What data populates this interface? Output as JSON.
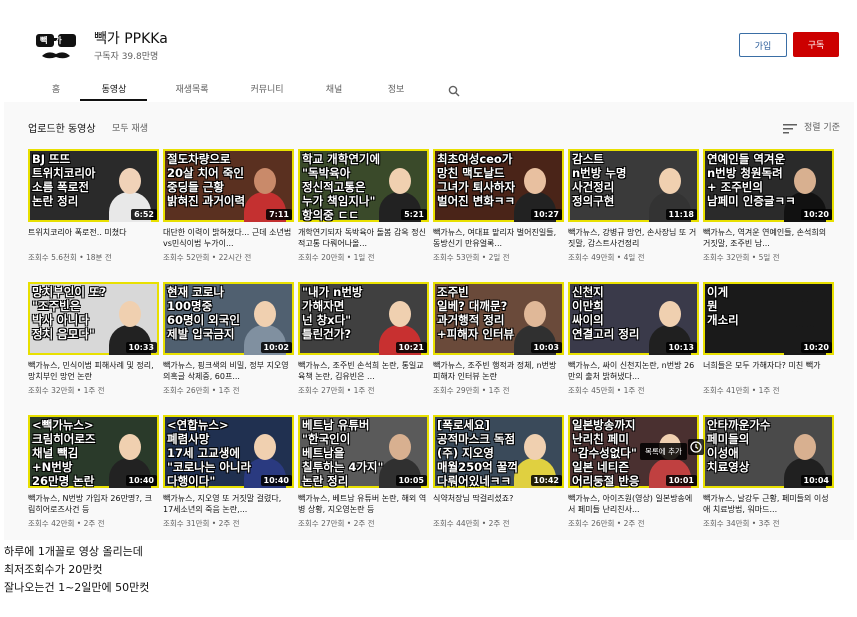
{
  "channel": {
    "name": "빽가 PPKKa",
    "subscribers": "구독자 39.8만명",
    "avatar_text": "빽가",
    "join_label": "가입",
    "subscribe_label": "구독"
  },
  "tabs": [
    {
      "label": "홈"
    },
    {
      "label": "동영상",
      "active": true
    },
    {
      "label": "재생목록"
    },
    {
      "label": "커뮤니티"
    },
    {
      "label": "채널"
    },
    {
      "label": "정보"
    }
  ],
  "search_icon": "search-icon",
  "section": {
    "title": "업로드한 동영상",
    "play_all": "모두 재생",
    "sort": "정렬 기준",
    "sort_icon": "sort-icon"
  },
  "videos": [
    {
      "thumb": "BJ 뜨뜨\n트위치코리아\n소름 폭로전\n논란 정리",
      "duration": "6:52",
      "title": "트위치코리아 폭로전.. 미쳤다",
      "meta": "조회수 5.6천회 • 18분 전",
      "bg": "#2a2a2a",
      "text_color": "#ffffff",
      "accent": "#e8e000",
      "skin": "#f0d2b8",
      "cloth": "#e8e8e8"
    },
    {
      "thumb": "절도차량으로\n20살 치어 죽인\n중딩들 근황\n밝혀진 과거이력",
      "duration": "7:11",
      "title": "대단한 이력이 밝혀졌다... 근데 소년법vs민식이법 누가이...",
      "meta": "조회수 52만회 • 22시간 전",
      "bg": "#5a3020",
      "text_color": "#ffffff",
      "accent": "#e8e000",
      "skin": "#c98a6a",
      "cloth": "#c43030"
    },
    {
      "thumb": "학교 개학연기에\n\"독박육아\n정신적고통은\n누가 책임지나\"\n항의중 ㄷㄷ",
      "duration": "5:21",
      "title": "개학연기되자 독박육아 돌봄 감옥 정신적고통 다뤄어나올...",
      "meta": "조회수 20만회 • 1일 전",
      "bg": "#3a4a2a",
      "text_color": "#ffffff",
      "accent": "#e8e000",
      "skin": "#f0d0b0",
      "cloth": "#222222"
    },
    {
      "thumb": "최초여성ceo가\n망친 맥도날드\n그녀가 퇴사하자\n벌어진 변화ㅋㅋ",
      "duration": "10:27",
      "title": "빽가뉴스, 여대표 맡리자 벌어진일들, 동방신기 만유얼록...",
      "meta": "조회수 53만회 • 2일 전",
      "bg": "#4a2418",
      "text_color": "#ffffff",
      "accent": "#e8e000",
      "skin": "#e8c0a0",
      "cloth": "#222222"
    },
    {
      "thumb": "감스트\nn번방 누명\n사건정리\n정의구현",
      "duration": "11:18",
      "title": "빽가뉴스, 강병규 망언, 손사장님 또 거짓말, 감스트사건정리",
      "meta": "조회수 49만회 • 4일 전",
      "bg": "#3a3a3a",
      "text_color": "#ffffff",
      "accent": "#e8e000",
      "skin": "#f0d0b0",
      "cloth": "#333333"
    },
    {
      "thumb": "연예인들 역겨운\nn번방 청원독려\n+ 조주빈의\n남페미 인증글ㅋㅋ",
      "duration": "10:20",
      "title": "빽가뉴스, 역겨운 연예인들, 손석희의 거짓말, 조주빈 남...",
      "meta": "조회수 32만회 • 5일 전",
      "bg": "#2a2a2a",
      "text_color": "#ffffff",
      "accent": "#e8e000",
      "skin": "#d8b090",
      "cloth": "#111111"
    },
    {
      "thumb": "망치부인이 또?\n\"조주빈은\n박사 아니다\n정치 음모다\"",
      "duration": "10:33",
      "title": "빽가뉴스, 민식이법 피해사례 및 정리, 망치부인 망언 논란",
      "meta": "조회수 32만회 • 1주 전",
      "bg": "#d8d8d8",
      "text_color": "#ffffff",
      "accent": "#e8e000",
      "skin": "#f0d0b0",
      "cloth": "#222222"
    },
    {
      "thumb": "현재 코로나\n100명중\n60명이 외국인\n제발 입국금지",
      "duration": "10:02",
      "title": "빽가뉴스, 핑크색의 비밀, 정부 지오영 의혹글 삭제중, 60프...",
      "meta": "조회수 26만회 • 1주 전",
      "bg": "#506070",
      "text_color": "#ffffff",
      "accent": "#e8e000",
      "skin": "#f0d0b0",
      "cloth": "#8090a0"
    },
    {
      "thumb": "\"내가 n번방\n가해자면\n넌 창x다\"\n틀린건가?",
      "duration": "10:21",
      "title": "빽가뉴스, 조주빈 손석희 논란, 통일교육책 논란, 김유빈은 ...",
      "meta": "조회수 27만회 • 1주 전",
      "bg": "#404040",
      "text_color": "#ffffff",
      "accent": "#e8e000",
      "skin": "#f0d0b0",
      "cloth": "#c83030"
    },
    {
      "thumb": "조주빈\n일베? 대깨문?\n과거행적 정리\n+피해자 인터뷰",
      "duration": "10:03",
      "title": "빽가뉴스, 조주빈 행적과 정체, n번방 피해자 인터뷰 논란",
      "meta": "조회수 29만회 • 1주 전",
      "bg": "#6a4a3a",
      "text_color": "#ffffff",
      "accent": "#e8e000",
      "skin": "#e0b898",
      "cloth": "#303030"
    },
    {
      "thumb": "신천지\n이만희\n싸이의\n연결고리 정리",
      "duration": "10:13",
      "title": "빽가뉴스, 싸이 신천지논란, n번방 26만의 출처 밝혀냈다...",
      "meta": "조회수 45만회 • 1주 전",
      "bg": "#3a3a4a",
      "text_color": "#ffffff",
      "accent": "#e8e000",
      "skin": "#f0d0b0",
      "cloth": "#202020"
    },
    {
      "thumb": "이게\n뭔\n개소리",
      "duration": "10:20",
      "title": "너희들은 모두 가해자다? 미친 빽가",
      "meta": "조회수 41만회 • 1주 전",
      "bg": "#1a1a1a",
      "text_color": "#ffffff",
      "accent": "#e8e000",
      "skin": "#1a1a1a",
      "cloth": "#1a1a1a"
    },
    {
      "thumb": "<빽가뉴스>\n크림히어로즈\n채널 빽김\n+N번방\n26만명 논란",
      "duration": "10:40",
      "title": "빽가뉴스, N번방 가입자 26만명?, 크림히어로즈사건 등",
      "meta": "조회수 42만회 • 2주 전",
      "bg": "#2a3a2a",
      "text_color": "#ffffff",
      "accent": "#e8e000",
      "skin": "#f0d0b0",
      "cloth": "#222222"
    },
    {
      "thumb": "<연합뉴스>\n폐렴사망\n17세 고교생에\n\"코로나는 아니라\n다행이다\"",
      "duration": "10:40",
      "title": "빽가뉴스, 지오영 또 거짓말 걸렸다, 17세소년의 죽음 논란,...",
      "meta": "조회수 31만회 • 2주 전",
      "bg": "#203050",
      "text_color": "#ffffff",
      "accent": "#e8e000",
      "skin": "#f0d0b0",
      "cloth": "#2a3a80"
    },
    {
      "thumb": "베트남 유튜버\n\"한국인이\n베트남을\n칠투하는 4가지\"\n논란 정리",
      "duration": "10:05",
      "title": "빽가뉴스, 베트남 유튜버 논란, 해외 역병 상황, 지오영논란 등",
      "meta": "조회수 27만회 • 2주 전",
      "bg": "#5a5a5a",
      "text_color": "#ffffff",
      "accent": "#e8e000",
      "skin": "#d8b090",
      "cloth": "#303030"
    },
    {
      "thumb": "[폭로세요]\n공적마스크 독점\n(주) 지오영\n매월250억 꿀꺽\n다뤄어있네ㅋㅋ",
      "duration": "10:42",
      "title": "식약처장님 딱걸리셨죠?",
      "meta": "조회수 44만회 • 2주 전",
      "bg": "#3a4a5a",
      "text_color": "#ffffff",
      "accent": "#e8e000",
      "skin": "#f0d0b0",
      "cloth": "#e0d040"
    },
    {
      "thumb": "일본방송까지\n난리친 페미\n\"감수성없다\"\n일본 네티즌\n어리둥절 반응",
      "duration": "10:01",
      "title": "빽가뉴스, 아이즈원(영상) 일본방송에서 페미들 난리친사...",
      "meta": "조회수 26만회 • 2주 전",
      "bg": "#4a3030",
      "text_color": "#ffffff",
      "accent": "#e8e000",
      "skin": "#f0d0b0",
      "cloth": "#c04040"
    },
    {
      "thumb": "안타까운가수\n페미들의\n이성애\n치료영상",
      "duration": "10:04",
      "title": "빽가뉴스, 날강두 근황, 페미들의 이성애 치료방법, 워마드...",
      "meta": "조회수 34만회 • 3주 전",
      "bg": "#4a4a4a",
      "text_color": "#ffffff",
      "accent": "#e8e000",
      "skin": "#d8b090",
      "cloth": "#202020"
    }
  ],
  "watch_later": "목록에 추가",
  "clock_icon": "clock-icon",
  "caption": [
    "하루에 1개꼴로 영상 올리는데",
    "최저조회수가 20만컷",
    "잘나오는건 1~2일만에 50만컷"
  ]
}
